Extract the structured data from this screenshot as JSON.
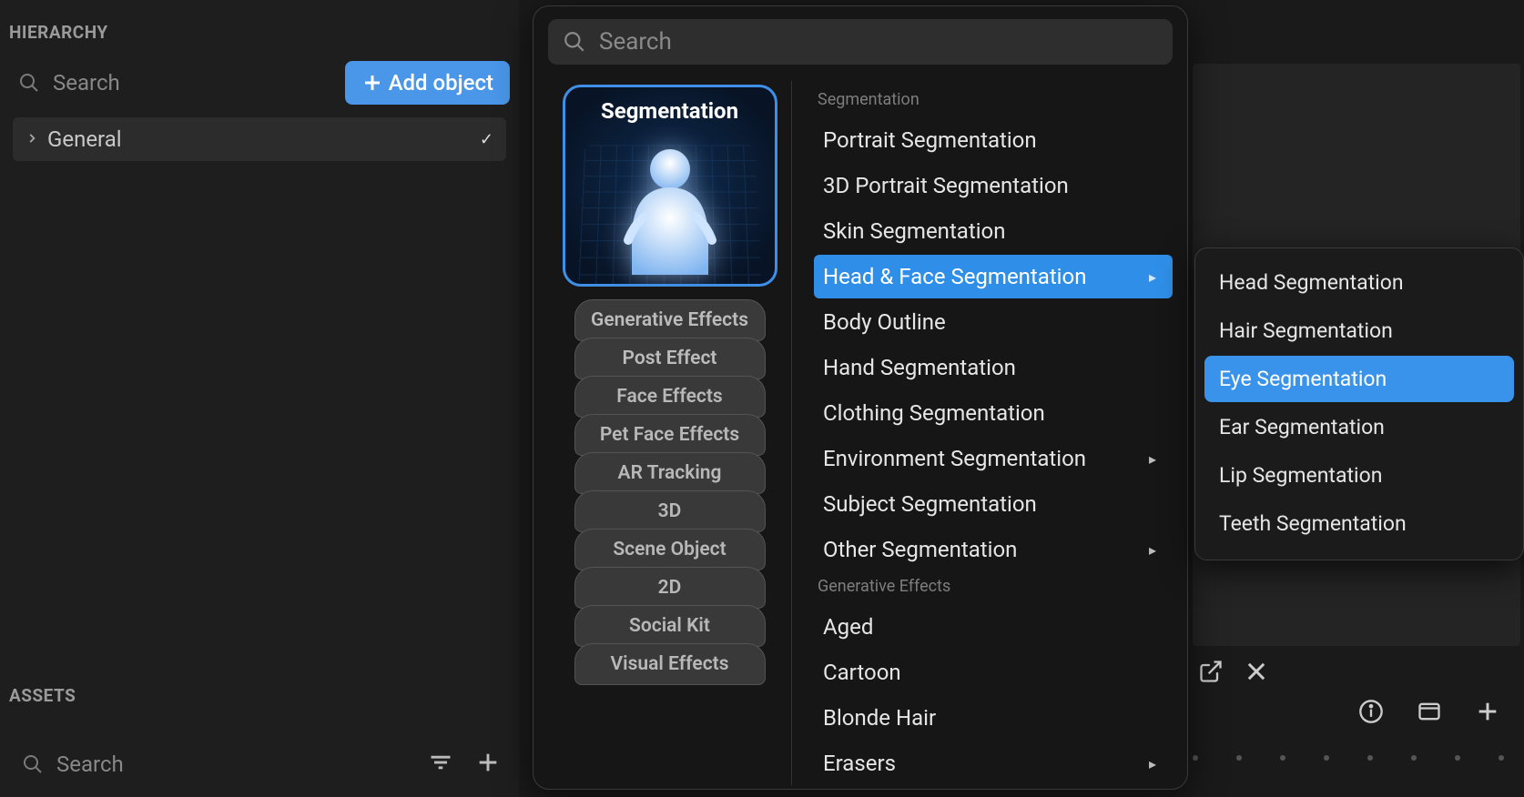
{
  "hierarchy": {
    "title": "HIERARCHY",
    "search_placeholder": "Search",
    "add_button": "Add object",
    "tree": {
      "root": "General"
    }
  },
  "assets": {
    "title": "ASSETS",
    "search_placeholder": "Search"
  },
  "popup": {
    "search_placeholder": "Search",
    "active_category": "Segmentation",
    "category_stack": [
      "Generative Effects",
      "Post Effect",
      "Face Effects",
      "Pet Face Effects",
      "AR Tracking",
      "3D",
      "Scene Object",
      "2D",
      "Social Kit",
      "Visual Effects"
    ],
    "groups": [
      {
        "title": "Segmentation",
        "items": [
          {
            "label": "Portrait Segmentation",
            "has_sub": false
          },
          {
            "label": "3D Portrait Segmentation",
            "has_sub": false
          },
          {
            "label": "Skin Segmentation",
            "has_sub": false
          },
          {
            "label": "Head & Face Segmentation",
            "has_sub": true,
            "selected": true
          },
          {
            "label": "Body Outline",
            "has_sub": false
          },
          {
            "label": "Hand Segmentation",
            "has_sub": false
          },
          {
            "label": "Clothing Segmentation",
            "has_sub": false
          },
          {
            "label": "Environment Segmentation",
            "has_sub": true
          },
          {
            "label": "Subject Segmentation",
            "has_sub": false
          },
          {
            "label": "Other Segmentation",
            "has_sub": true
          }
        ]
      },
      {
        "title": "Generative Effects",
        "items": [
          {
            "label": "Aged",
            "has_sub": false
          },
          {
            "label": "Cartoon",
            "has_sub": false
          },
          {
            "label": "Blonde Hair",
            "has_sub": false
          },
          {
            "label": "Erasers",
            "has_sub": true
          }
        ]
      }
    ]
  },
  "flyout": {
    "items": [
      {
        "label": "Head Segmentation"
      },
      {
        "label": "Hair Segmentation"
      },
      {
        "label": "Eye Segmentation",
        "selected": true
      },
      {
        "label": "Ear Segmentation"
      },
      {
        "label": "Lip Segmentation"
      },
      {
        "label": "Teeth Segmentation"
      }
    ]
  }
}
